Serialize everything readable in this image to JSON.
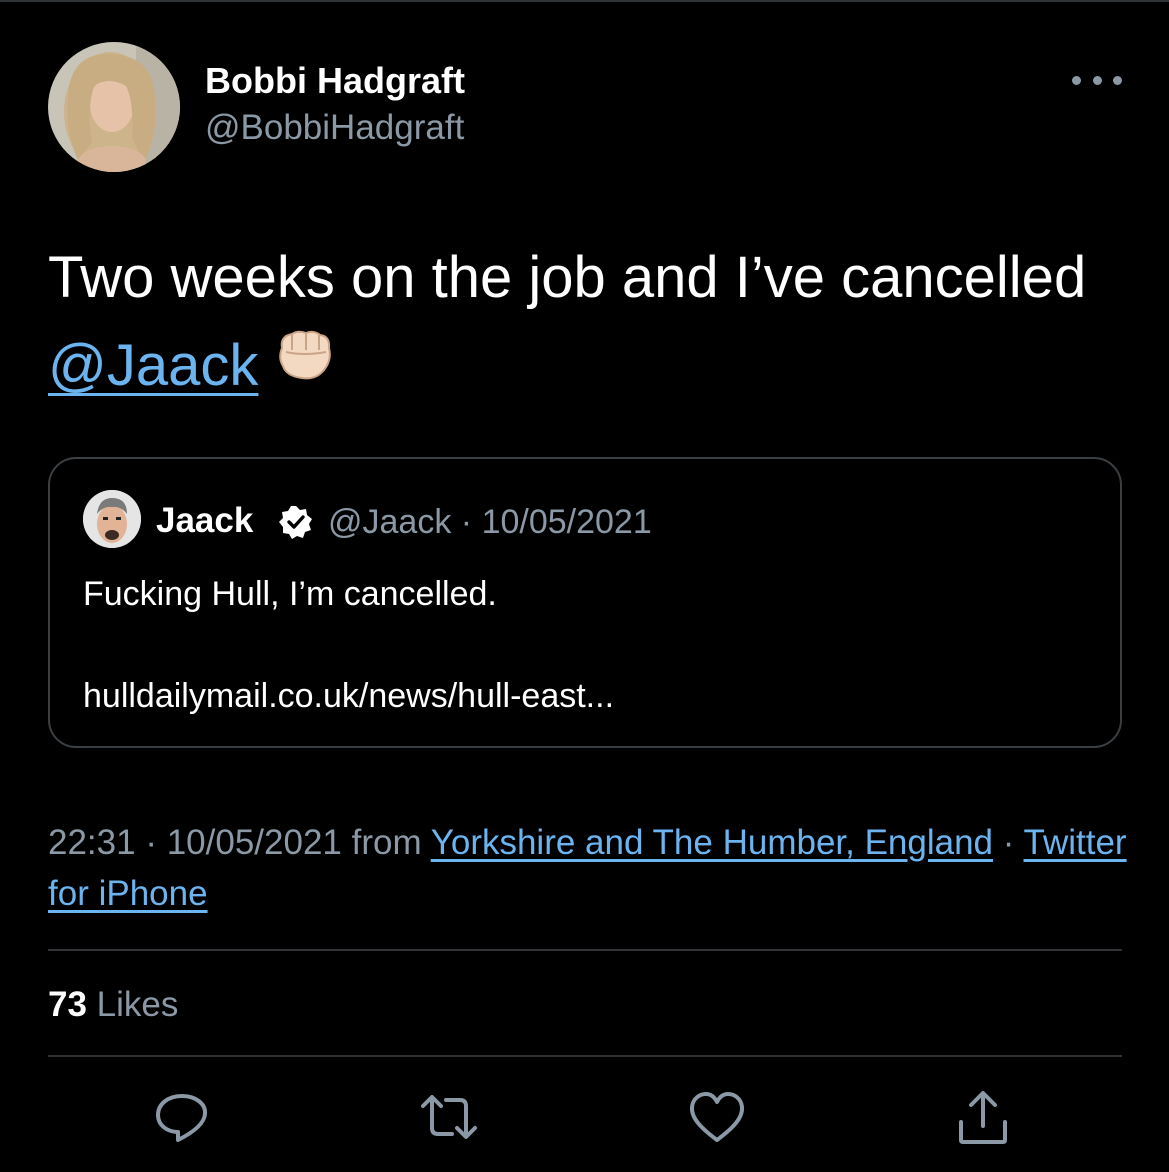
{
  "author": {
    "name": "Bobbi Hadgraft",
    "handle": "@BobbiHadgraft"
  },
  "tweet": {
    "text": "Two weeks on the job and I’ve cancelled",
    "mention": "@Jaack",
    "emoji": "fist-icon"
  },
  "quoted_tweet": {
    "name": "Jaack",
    "handle": "@Jaack",
    "date": "10/05/2021",
    "text": "Fucking Hull, I’m cancelled.",
    "link": "hulldailymail.co.uk/news/hull-east..."
  },
  "meta": {
    "time": "22:31",
    "date": "10/05/2021",
    "from_label": "from",
    "location": "Yorkshire and The Humber, England",
    "client": "Twitter for iPhone"
  },
  "engagement": {
    "likes_count": "73",
    "likes_label": "Likes"
  },
  "actions": [
    "reply-icon",
    "retweet-icon",
    "like-icon",
    "share-icon"
  ],
  "colors": {
    "background": "#000000",
    "text": "#ffffff",
    "secondary": "#8b98a5",
    "link": "#6cb4ef",
    "border": "#2f3336"
  }
}
